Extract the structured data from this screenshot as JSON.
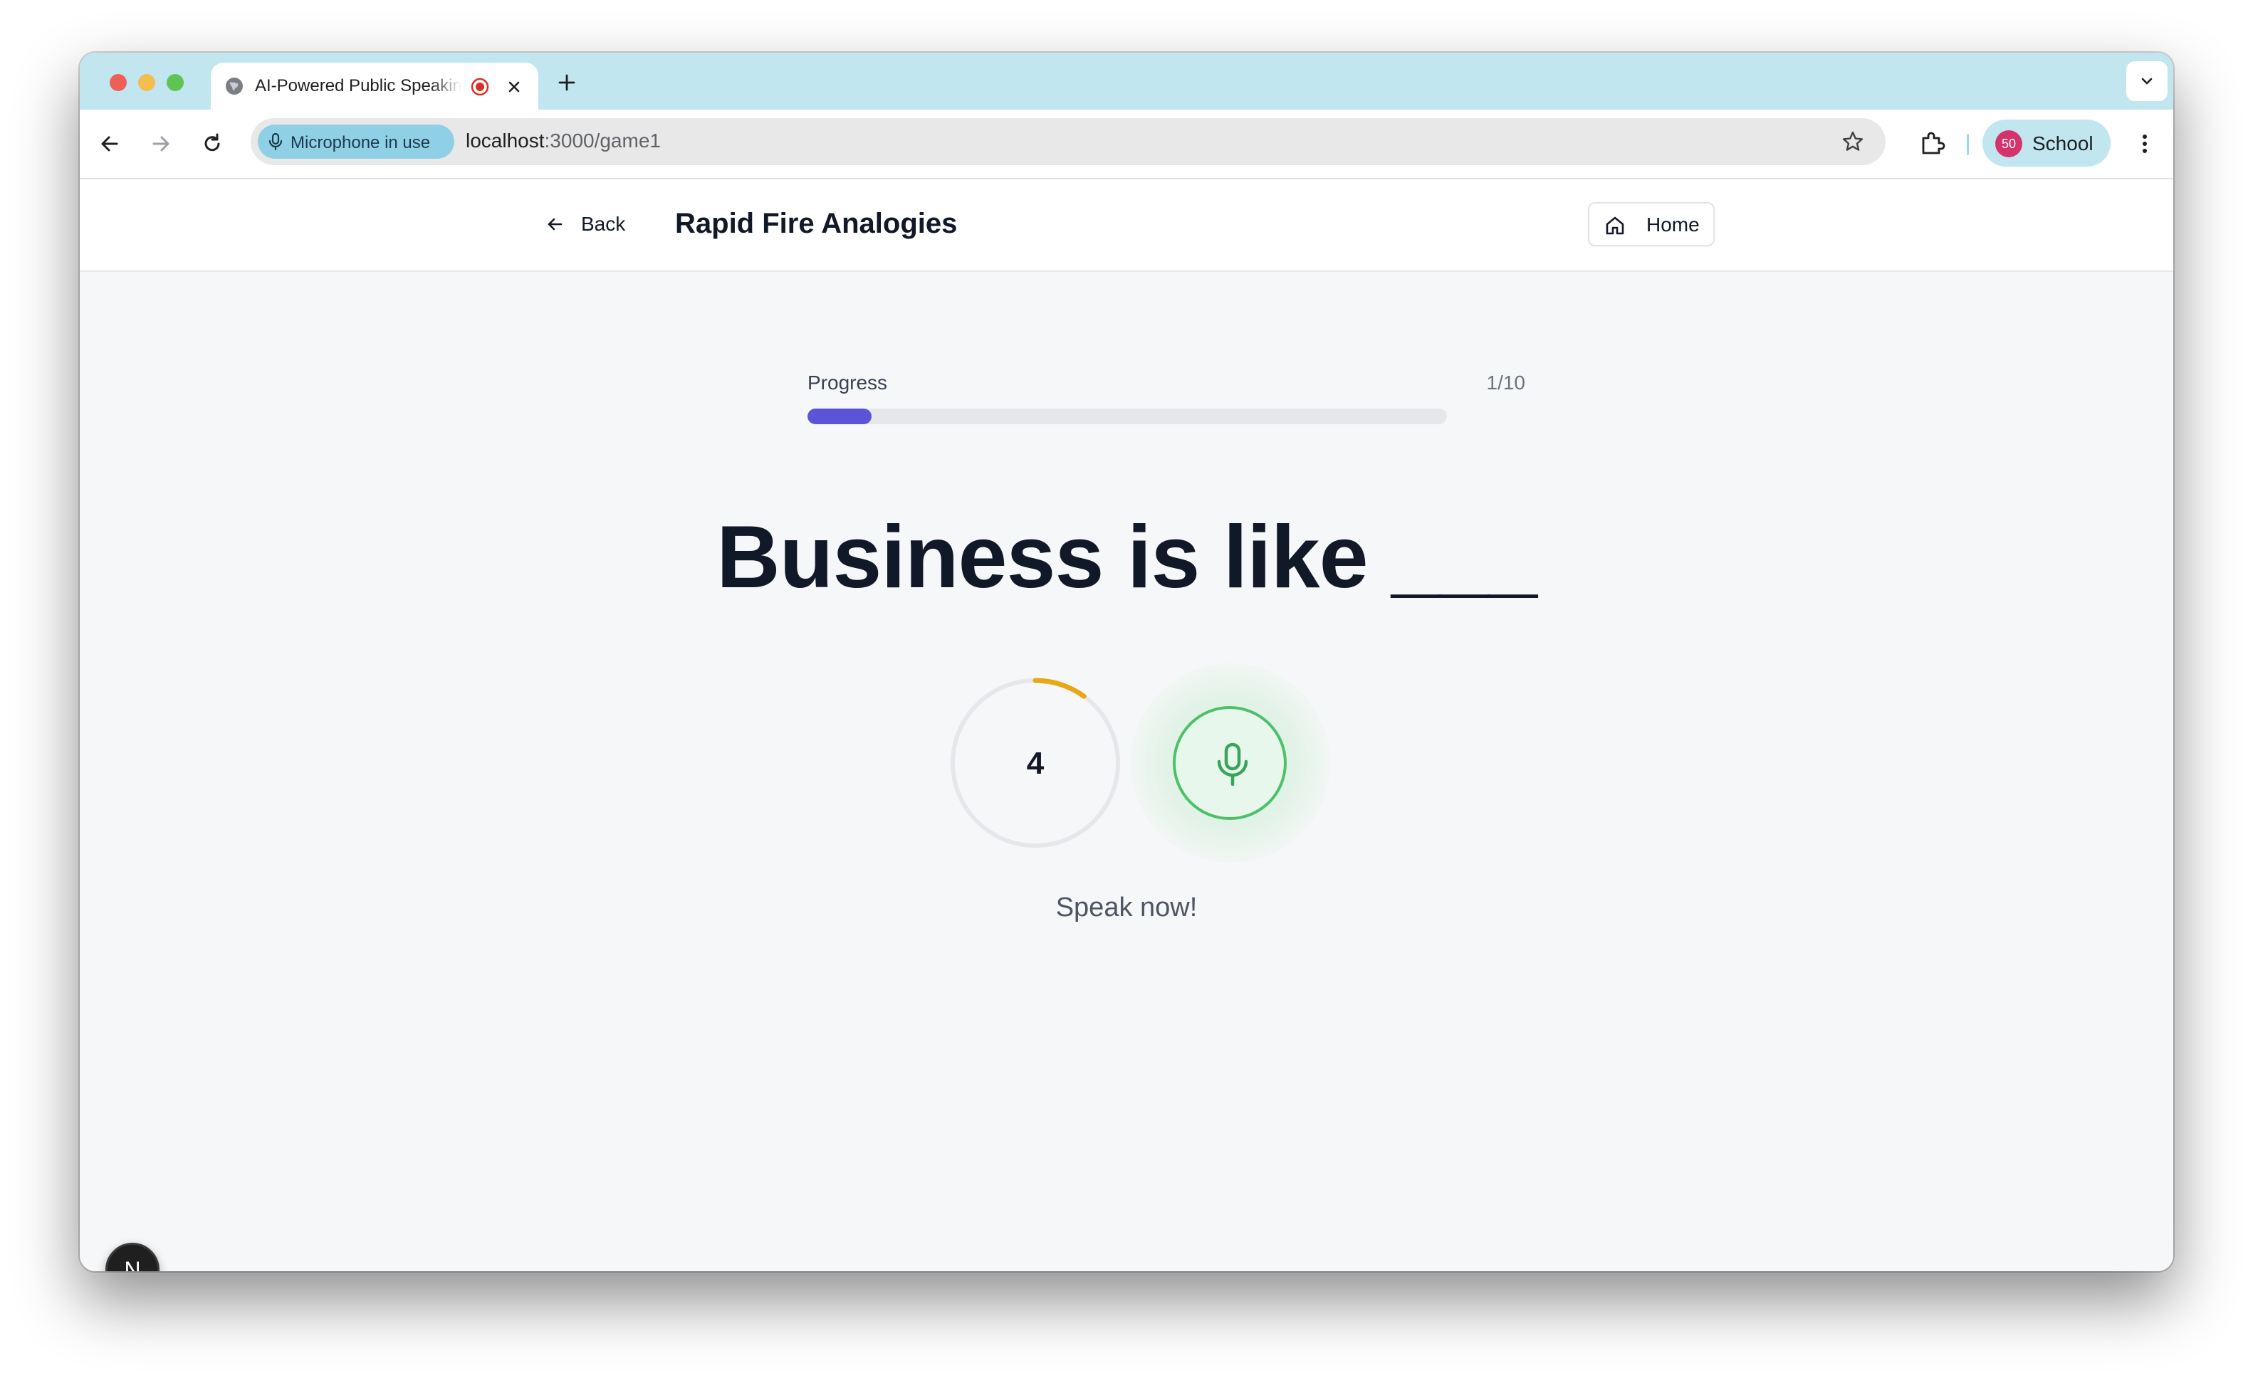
{
  "browser": {
    "tab": {
      "title": "AI-Powered Public Speaking",
      "icon": "globe-icon",
      "recording_icon": "recording-icon"
    },
    "mic_chip": "Microphone in use",
    "url_host": "localhost",
    "url_path": ":3000/game1",
    "profile": {
      "badge": "50",
      "label": "School",
      "badge_color": "#d6336c"
    }
  },
  "header": {
    "back_label": "Back",
    "title": "Rapid Fire Analogies",
    "home_label": "Home"
  },
  "progress": {
    "label": "Progress",
    "count": "1/10",
    "fraction": 0.1,
    "fill_color": "#5b54d6"
  },
  "prompt": "Business is like ___",
  "timer": {
    "value": "4",
    "arc_color": "#e6a817",
    "remaining_fraction": 0.1
  },
  "mic": {
    "color": "#4cc06a",
    "icon": "microphone-icon"
  },
  "status": "Speak now!",
  "dev_badge": "N"
}
